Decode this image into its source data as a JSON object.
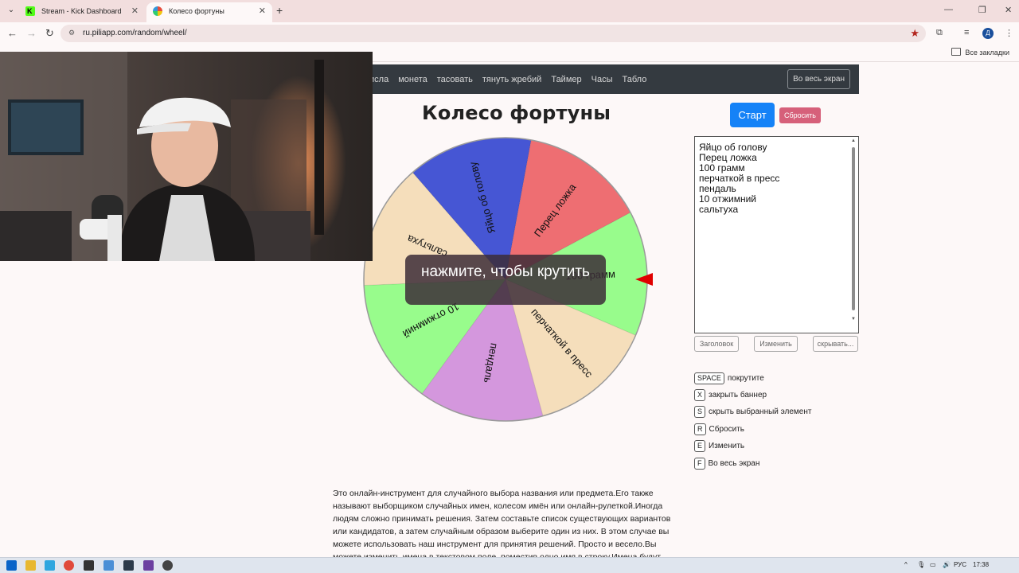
{
  "browser": {
    "tabs": [
      {
        "title": "Stream - Kick Dashboard"
      },
      {
        "title": "Колесо фортуны"
      }
    ],
    "url": "ru.piliapp.com/random/wheel/",
    "bookmarks_all": "Все закладки",
    "profile_initial": "Д"
  },
  "site_nav": {
    "links": [
      "исла",
      "монета",
      "тасовать",
      "тянуть жребий",
      "Таймер",
      "Часы",
      "Табло"
    ],
    "fullscreen_label": "Во весь экран"
  },
  "page": {
    "title": "Колесо фортуны",
    "start_label": "Старт",
    "reset_label": "Сбросить",
    "spin_overlay": "нажмите, чтобы крутить"
  },
  "wheel": {
    "segments": [
      {
        "label": "Яйцо об голову",
        "color": "#4656d4"
      },
      {
        "label": "Перец ложка",
        "color": "#ee6e72"
      },
      {
        "label": "100 грамм",
        "color": "#98fc8c"
      },
      {
        "label": "перчаткой в пресс",
        "color": "#f5debb"
      },
      {
        "label": "пендаль",
        "color": "#d497dd"
      },
      {
        "label": "10 отжимний",
        "color": "#98fc8c"
      },
      {
        "label": "сальтуха",
        "color": "#f5debb"
      }
    ]
  },
  "names_box": {
    "lines": [
      "Яйцо об голову",
      "Перец ложка",
      "100 грамм",
      "перчаткой в пресс",
      "пендаль",
      "10 отжимний",
      "сальтуха"
    ]
  },
  "controls": {
    "header_label": "Заголовок",
    "edit_label": "Изменить",
    "hide_label": "скрывать..."
  },
  "shortcuts": [
    {
      "key": "SPACE",
      "label": "покрутите"
    },
    {
      "key": "X",
      "label": "закрыть баннер"
    },
    {
      "key": "S",
      "label": "скрыть выбранный элемент"
    },
    {
      "key": "R",
      "label": "Сбросить"
    },
    {
      "key": "E",
      "label": "Изменить"
    },
    {
      "key": "F",
      "label": "Во весь экран"
    }
  ],
  "description": "Это онлайн-инструмент для случайного выбора названия или предмета.Его также называют выборщиком случайных имен, колесом имён или онлайн-рулеткой.Иногда людям сложно принимать решения. Затем составьте список существующих вариантов или кандидатов, а затем случайным образом выберите один из них. В этом случае вы можете использовать наш инструмент для принятия решений. Просто и весело.Вы можете изменить имена в текстовом поле, поместив одно имя в строку.Имена будут",
  "taskbar": {
    "lang": "РУС",
    "time": "17:38"
  }
}
